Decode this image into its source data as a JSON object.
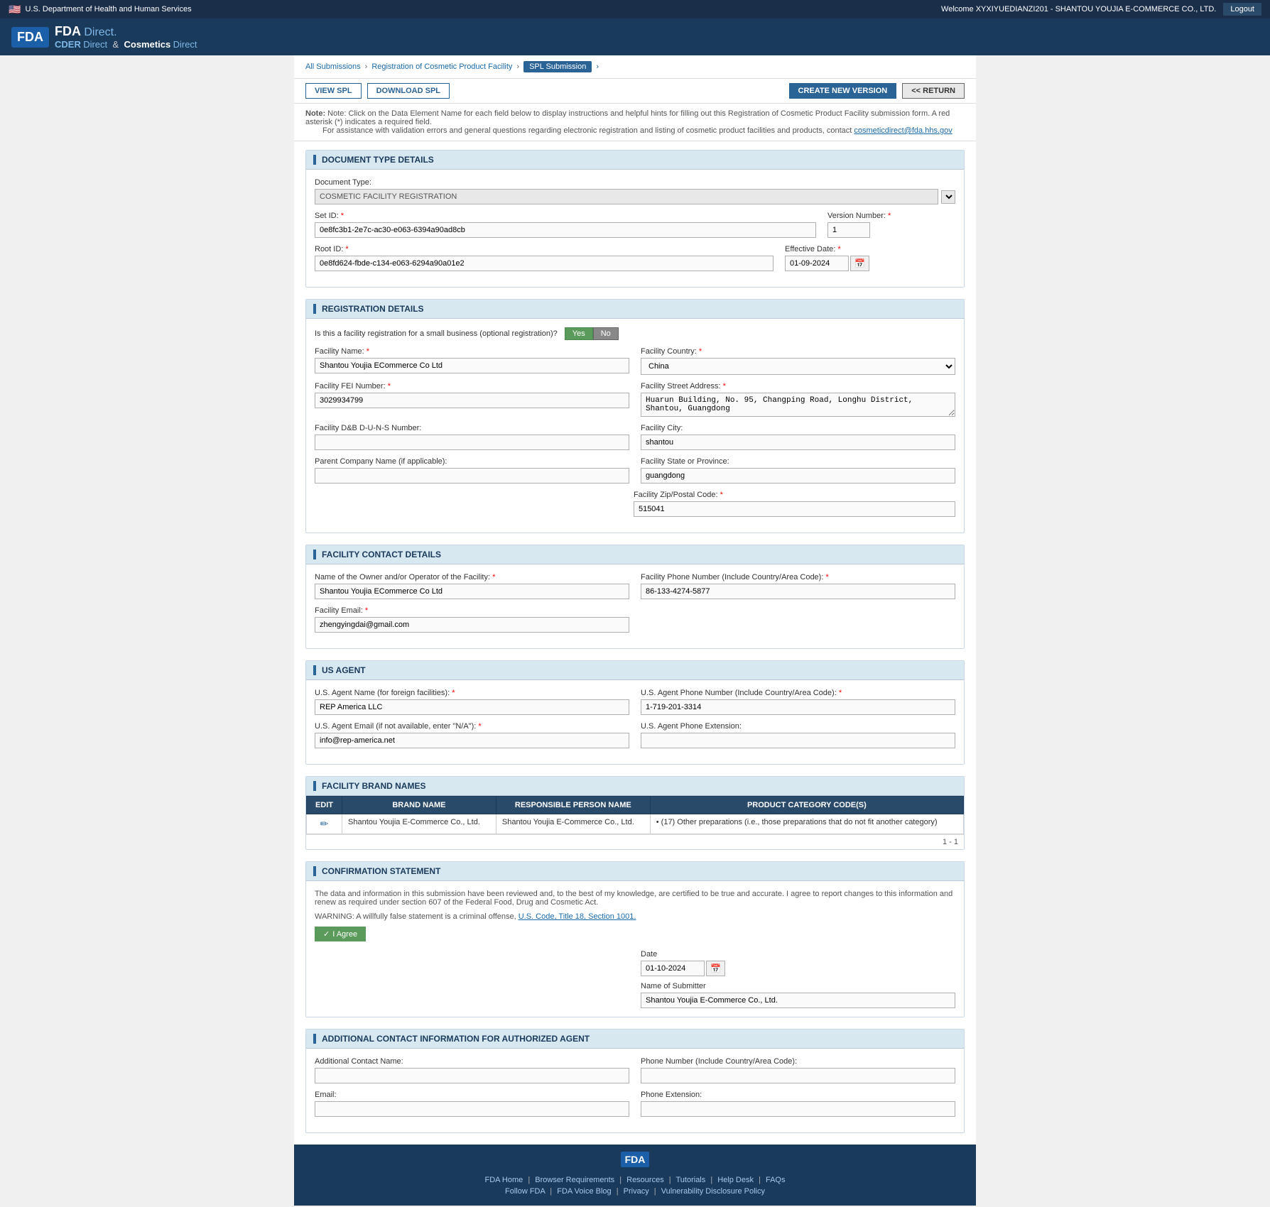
{
  "topBar": {
    "dept": "U.S. Department of Health and Human Services",
    "welcome": "Welcome XYXIYUEDIANZI201 - SHANTOU YOUJIA E-COMMERCE CO., LTD.",
    "logout": "Logout"
  },
  "fdaLogo": {
    "box": "FDA",
    "text1": "Direct.",
    "cder": "CDER",
    "cderDirect": "Direct",
    "amp": "&",
    "cosmetics": "Cosmetics",
    "cosmeticsDirect": "Direct"
  },
  "breadcrumb": {
    "allSubmissions": "All Submissions",
    "registration": "Registration of Cosmetic Product Facility",
    "splSubmission": "SPL Submission"
  },
  "toolbar": {
    "viewSpl": "VIEW SPL",
    "downloadSpl": "DOWNLOAD SPL",
    "createNewVersion": "CREATE NEW VERSION",
    "return": "<< RETURN"
  },
  "noteText": "Note: Click on the Data Element Name for each field below to display instructions and helpful hints for filling out this Registration of Cosmetic Product Facility submission form. A red asterisk (*) indicates a required field.",
  "assistanceText": "For assistance with validation errors and general questions regarding electronic registration and listing of cosmetic product facilities and products, contact",
  "assistanceEmail": "cosmeticdirect@fda.hhs.gov",
  "sections": {
    "documentType": {
      "title": "DOCUMENT TYPE DETAILS",
      "documentTypeLabel": "Document Type:",
      "documentTypeValue": "COSMETIC FACILITY REGISTRATION",
      "setIdLabel": "Set ID:",
      "setIdValue": "0e8fc3b1-2e7c-ac30-e063-6394a90ad8cb",
      "versionNumberLabel": "Version Number:",
      "versionNumberValue": "1",
      "rootIdLabel": "Root ID:",
      "rootIdValue": "0e8fd624-fbde-c134-e063-6294a90a01e2",
      "effectiveDateLabel": "Effective Date:",
      "effectiveDateValue": "01-09-2024"
    },
    "registration": {
      "title": "REGISTRATION DETAILS",
      "smallBizQuestion": "Is this a facility registration for a small business (optional registration)?",
      "yesLabel": "Yes",
      "noLabel": "No",
      "facilityNameLabel": "Facility Name:",
      "facilityNameValue": "Shantou Youjia ECommerce Co Ltd",
      "facilityCountryLabel": "Facility Country:",
      "facilityCountryValue": "China",
      "facilityFeiLabel": "Facility FEI Number:",
      "facilityFeiValue": "3029934799",
      "facilityStreetLabel": "Facility Street Address:",
      "facilityStreetValue": "Huarun Building, No. 95, Changping Road, Longhu District, Shantou, Guangdong",
      "facilityDnbLabel": "Facility D&B D-U-N-S Number:",
      "facilityDnbValue": "",
      "facilityCityLabel": "Facility City:",
      "facilityCityValue": "shantou",
      "parentCompanyLabel": "Parent Company Name (if applicable):",
      "parentCompanyValue": "",
      "facilityStateLabel": "Facility State or Province:",
      "facilityStateValue": "guangdong",
      "facilityZipLabel": "Facility Zip/Postal Code:",
      "facilityZipValue": "515041"
    },
    "facilityContact": {
      "title": "FACILITY CONTACT DETAILS",
      "ownerNameLabel": "Name of the Owner and/or Operator of the Facility:",
      "ownerNameValue": "Shantou Youjia ECommerce Co Ltd",
      "facilityPhoneLabel": "Facility Phone Number (Include Country/Area Code):",
      "facilityPhoneValue": "86-133-4274-5877",
      "facilityEmailLabel": "Facility Email:",
      "facilityEmailValue": "zhengyingdai@gmail.com"
    },
    "usAgent": {
      "title": "US AGENT",
      "agentNameLabel": "U.S. Agent Name (for foreign facilities):",
      "agentNameValue": "REP America LLC",
      "agentPhoneLabel": "U.S. Agent Phone Number (Include Country/Area Code):",
      "agentPhoneValue": "1-719-201-3314",
      "agentEmailLabel": "U.S. Agent Email (if not available, enter \"N/A\"):",
      "agentEmailValue": "info@rep-america.net",
      "agentPhoneExtLabel": "U.S. Agent Phone Extension:",
      "agentPhoneExtValue": ""
    },
    "brandNames": {
      "title": "FACILITY BRAND NAMES",
      "columns": {
        "edit": "EDIT",
        "brandName": "BRAND NAME",
        "responsiblePerson": "RESPONSIBLE PERSON NAME",
        "productCategory": "PRODUCT CATEGORY CODE(S)"
      },
      "rows": [
        {
          "brandName": "Shantou Youjia E-Commerce Co., Ltd.",
          "responsiblePerson": "Shantou Youjia E-Commerce Co., Ltd.",
          "productCategory": "• (17) Other preparations (i.e., those preparations that do not fit another category)"
        }
      ],
      "pagination": "1 - 1"
    },
    "confirmation": {
      "title": "CONFIRMATION STATEMENT",
      "bodyText": "The data and information in this submission have been reviewed and, to the best of my knowledge, are certified to be true and accurate. I agree to report changes to this information and renew as required under section 607 of the Federal Food, Drug and Cosmetic Act.",
      "warningText": "WARNING: A willfully false statement is a criminal offense,",
      "warningLink": "U.S. Code, Title 18, Section 1001.",
      "agreeBtn": "I Agree",
      "dateLabel": "Date",
      "dateValue": "01-10-2024",
      "submitterLabel": "Name of Submitter",
      "submitterValue": "Shantou Youjia E-Commerce Co., Ltd."
    },
    "additionalContact": {
      "title": "ADDITIONAL CONTACT INFORMATION FOR AUTHORIZED AGENT",
      "contactNameLabel": "Additional Contact Name:",
      "contactNameValue": "",
      "phoneLabel": "Phone Number (Include Country/Area Code):",
      "phoneValue": "",
      "emailLabel": "Email:",
      "emailValue": "",
      "phoneExtLabel": "Phone Extension:",
      "phoneExtValue": ""
    }
  },
  "footer": {
    "links1": [
      "FDA Home",
      "Browser Requirements",
      "Resources",
      "Tutorials",
      "Help Desk",
      "FAQs"
    ],
    "links2": [
      "Follow FDA",
      "FDA Voice Blog",
      "Privacy",
      "Vulnerability Disclosure Policy"
    ]
  }
}
